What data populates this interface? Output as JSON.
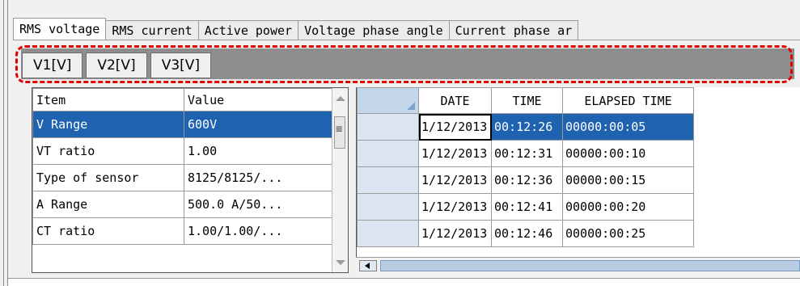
{
  "tabs": [
    {
      "label": "RMS voltage"
    },
    {
      "label": "RMS current"
    },
    {
      "label": "Active power"
    },
    {
      "label": "Voltage phase angle"
    },
    {
      "label": "Current phase ar"
    }
  ],
  "subtabs": [
    {
      "label": "V1[V]"
    },
    {
      "label": "V2[V]"
    },
    {
      "label": "V3[V]"
    }
  ],
  "settings": {
    "headers": {
      "item": "Item",
      "value": "Value"
    },
    "rows": [
      {
        "item": "V Range",
        "value": "600V"
      },
      {
        "item": "VT ratio",
        "value": "1.00"
      },
      {
        "item": "Type of sensor",
        "value": "8125/8125/..."
      },
      {
        "item": "A Range",
        "value": "500.0 A/50..."
      },
      {
        "item": "CT ratio",
        "value": "1.00/1.00/..."
      }
    ]
  },
  "records": {
    "headers": {
      "date": "DATE",
      "time": "TIME",
      "elapsed": "ELAPSED TIME"
    },
    "rows": [
      {
        "date": "1/12/2013",
        "time": "00:12:26",
        "elapsed": "00000:00:05"
      },
      {
        "date": "1/12/2013",
        "time": "00:12:31",
        "elapsed": "00000:00:10"
      },
      {
        "date": "1/12/2013",
        "time": "00:12:36",
        "elapsed": "00000:00:15"
      },
      {
        "date": "1/12/2013",
        "time": "00:12:41",
        "elapsed": "00000:00:20"
      },
      {
        "date": "1/12/2013",
        "time": "00:12:46",
        "elapsed": "00000:00:25"
      }
    ]
  },
  "colors": {
    "selection": "#1e62b0",
    "highlight_border": "#e00000",
    "subtab_bar": "#8e8e8e"
  }
}
